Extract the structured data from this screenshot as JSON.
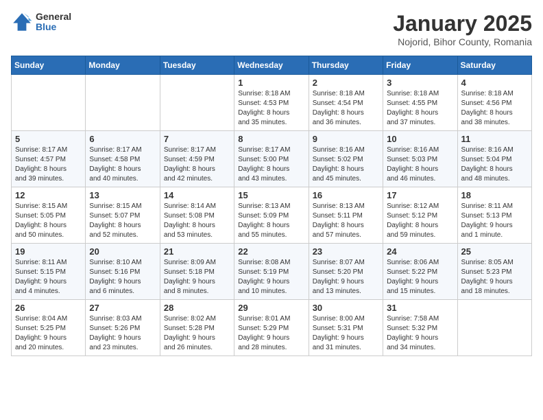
{
  "logo": {
    "general": "General",
    "blue": "Blue"
  },
  "header": {
    "month": "January 2025",
    "location": "Nojorid, Bihor County, Romania"
  },
  "weekdays": [
    "Sunday",
    "Monday",
    "Tuesday",
    "Wednesday",
    "Thursday",
    "Friday",
    "Saturday"
  ],
  "weeks": [
    [
      {
        "day": "",
        "info": ""
      },
      {
        "day": "",
        "info": ""
      },
      {
        "day": "",
        "info": ""
      },
      {
        "day": "1",
        "info": "Sunrise: 8:18 AM\nSunset: 4:53 PM\nDaylight: 8 hours\nand 35 minutes."
      },
      {
        "day": "2",
        "info": "Sunrise: 8:18 AM\nSunset: 4:54 PM\nDaylight: 8 hours\nand 36 minutes."
      },
      {
        "day": "3",
        "info": "Sunrise: 8:18 AM\nSunset: 4:55 PM\nDaylight: 8 hours\nand 37 minutes."
      },
      {
        "day": "4",
        "info": "Sunrise: 8:18 AM\nSunset: 4:56 PM\nDaylight: 8 hours\nand 38 minutes."
      }
    ],
    [
      {
        "day": "5",
        "info": "Sunrise: 8:17 AM\nSunset: 4:57 PM\nDaylight: 8 hours\nand 39 minutes."
      },
      {
        "day": "6",
        "info": "Sunrise: 8:17 AM\nSunset: 4:58 PM\nDaylight: 8 hours\nand 40 minutes."
      },
      {
        "day": "7",
        "info": "Sunrise: 8:17 AM\nSunset: 4:59 PM\nDaylight: 8 hours\nand 42 minutes."
      },
      {
        "day": "8",
        "info": "Sunrise: 8:17 AM\nSunset: 5:00 PM\nDaylight: 8 hours\nand 43 minutes."
      },
      {
        "day": "9",
        "info": "Sunrise: 8:16 AM\nSunset: 5:02 PM\nDaylight: 8 hours\nand 45 minutes."
      },
      {
        "day": "10",
        "info": "Sunrise: 8:16 AM\nSunset: 5:03 PM\nDaylight: 8 hours\nand 46 minutes."
      },
      {
        "day": "11",
        "info": "Sunrise: 8:16 AM\nSunset: 5:04 PM\nDaylight: 8 hours\nand 48 minutes."
      }
    ],
    [
      {
        "day": "12",
        "info": "Sunrise: 8:15 AM\nSunset: 5:05 PM\nDaylight: 8 hours\nand 50 minutes."
      },
      {
        "day": "13",
        "info": "Sunrise: 8:15 AM\nSunset: 5:07 PM\nDaylight: 8 hours\nand 52 minutes."
      },
      {
        "day": "14",
        "info": "Sunrise: 8:14 AM\nSunset: 5:08 PM\nDaylight: 8 hours\nand 53 minutes."
      },
      {
        "day": "15",
        "info": "Sunrise: 8:13 AM\nSunset: 5:09 PM\nDaylight: 8 hours\nand 55 minutes."
      },
      {
        "day": "16",
        "info": "Sunrise: 8:13 AM\nSunset: 5:11 PM\nDaylight: 8 hours\nand 57 minutes."
      },
      {
        "day": "17",
        "info": "Sunrise: 8:12 AM\nSunset: 5:12 PM\nDaylight: 8 hours\nand 59 minutes."
      },
      {
        "day": "18",
        "info": "Sunrise: 8:11 AM\nSunset: 5:13 PM\nDaylight: 9 hours\nand 1 minute."
      }
    ],
    [
      {
        "day": "19",
        "info": "Sunrise: 8:11 AM\nSunset: 5:15 PM\nDaylight: 9 hours\nand 4 minutes."
      },
      {
        "day": "20",
        "info": "Sunrise: 8:10 AM\nSunset: 5:16 PM\nDaylight: 9 hours\nand 6 minutes."
      },
      {
        "day": "21",
        "info": "Sunrise: 8:09 AM\nSunset: 5:18 PM\nDaylight: 9 hours\nand 8 minutes."
      },
      {
        "day": "22",
        "info": "Sunrise: 8:08 AM\nSunset: 5:19 PM\nDaylight: 9 hours\nand 10 minutes."
      },
      {
        "day": "23",
        "info": "Sunrise: 8:07 AM\nSunset: 5:20 PM\nDaylight: 9 hours\nand 13 minutes."
      },
      {
        "day": "24",
        "info": "Sunrise: 8:06 AM\nSunset: 5:22 PM\nDaylight: 9 hours\nand 15 minutes."
      },
      {
        "day": "25",
        "info": "Sunrise: 8:05 AM\nSunset: 5:23 PM\nDaylight: 9 hours\nand 18 minutes."
      }
    ],
    [
      {
        "day": "26",
        "info": "Sunrise: 8:04 AM\nSunset: 5:25 PM\nDaylight: 9 hours\nand 20 minutes."
      },
      {
        "day": "27",
        "info": "Sunrise: 8:03 AM\nSunset: 5:26 PM\nDaylight: 9 hours\nand 23 minutes."
      },
      {
        "day": "28",
        "info": "Sunrise: 8:02 AM\nSunset: 5:28 PM\nDaylight: 9 hours\nand 26 minutes."
      },
      {
        "day": "29",
        "info": "Sunrise: 8:01 AM\nSunset: 5:29 PM\nDaylight: 9 hours\nand 28 minutes."
      },
      {
        "day": "30",
        "info": "Sunrise: 8:00 AM\nSunset: 5:31 PM\nDaylight: 9 hours\nand 31 minutes."
      },
      {
        "day": "31",
        "info": "Sunrise: 7:58 AM\nSunset: 5:32 PM\nDaylight: 9 hours\nand 34 minutes."
      },
      {
        "day": "",
        "info": ""
      }
    ]
  ]
}
